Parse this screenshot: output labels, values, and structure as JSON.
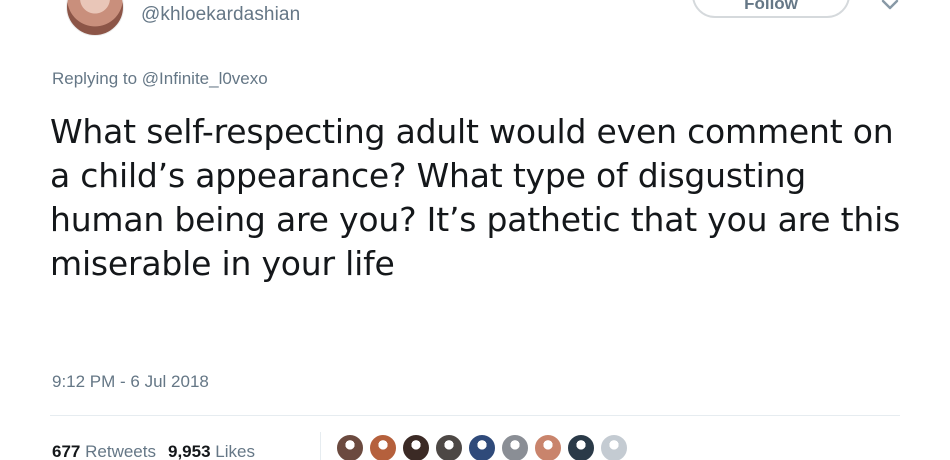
{
  "tweet": {
    "handle": "@khloekardashian",
    "follow_label": "Follow",
    "reply_prefix": "Replying to ",
    "reply_mention": "@Infinite_l0vexo",
    "text": "What self-respecting adult would even comment on a child’s appearance? What type of disgusting human being are you? It’s pathetic that you are this miserable in your life",
    "timestamp": "9:12 PM - 6 Jul 2018",
    "retweets_count": "677",
    "retweets_label": "Retweets",
    "likes_count": "9,953",
    "likes_label": "Likes"
  },
  "likers": [
    {
      "name": "liker-avatar-1",
      "color": "#6b4a3f"
    },
    {
      "name": "liker-avatar-2",
      "color": "#b5603c"
    },
    {
      "name": "liker-avatar-3",
      "color": "#3b2a25"
    },
    {
      "name": "liker-avatar-4",
      "color": "#4d4845"
    },
    {
      "name": "liker-avatar-5",
      "color": "#2f4a7a"
    },
    {
      "name": "liker-avatar-6",
      "color": "#8a8e95"
    },
    {
      "name": "liker-avatar-7",
      "color": "#c9846c"
    },
    {
      "name": "liker-avatar-8",
      "color": "#2a3a48"
    },
    {
      "name": "liker-avatar-9",
      "color": "#c4cbd2"
    }
  ],
  "colors": {
    "text_primary": "#14171a",
    "text_secondary": "#657786",
    "divider": "#e6ecf0"
  }
}
